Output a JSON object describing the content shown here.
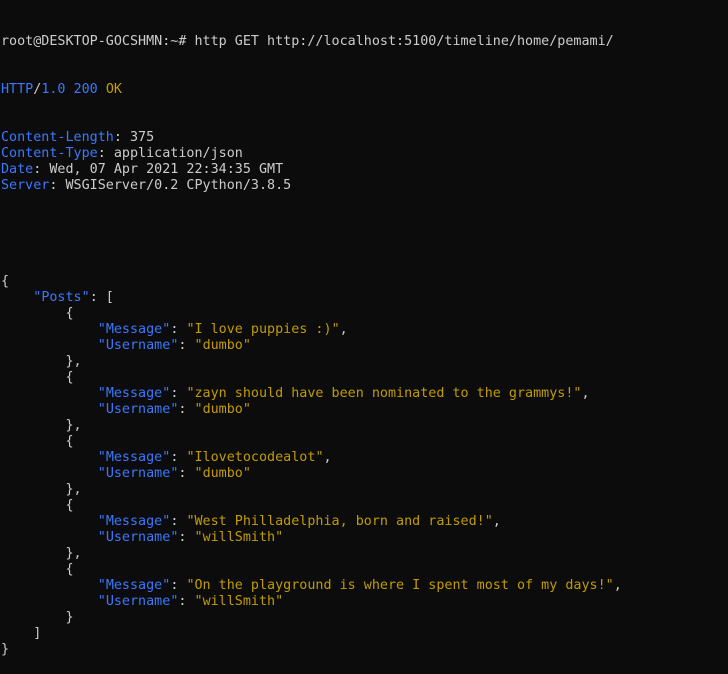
{
  "terminal": {
    "prompt": "root@DESKTOP-GOCSHMN:~# ",
    "command": "http GET http://localhost:5100/timeline/home/pemami/"
  },
  "response": {
    "protocol": "HTTP",
    "slash": "/",
    "version": "1.0",
    "status_code": "200",
    "status_text": "OK",
    "headers": [
      {
        "key": "Content-Length",
        "value": "375"
      },
      {
        "key": "Content-Type",
        "value": "application/json"
      },
      {
        "key": "Date",
        "value": "Wed, 07 Apr 2021 22:34:35 GMT"
      },
      {
        "key": "Server",
        "value": "WSGIServer/0.2 CPython/3.8.5"
      }
    ]
  },
  "json": {
    "root_key": "Posts",
    "message_key": "Message",
    "username_key": "Username",
    "posts": [
      {
        "message": "I love puppies :)",
        "username": "dumbo"
      },
      {
        "message": "zayn should have been nominated to the grammys!",
        "username": "dumbo"
      },
      {
        "message": "Ilovetocodealot",
        "username": "dumbo"
      },
      {
        "message": "West Philladelphia, born and raised!",
        "username": "willSmith"
      },
      {
        "message": "On the playground is where I spent most of my days!",
        "username": "willSmith"
      }
    ]
  },
  "colors": {
    "background": "#0c0c0c",
    "foreground": "#cccccc",
    "key": "#3b78ff",
    "string": "#c19c00"
  }
}
